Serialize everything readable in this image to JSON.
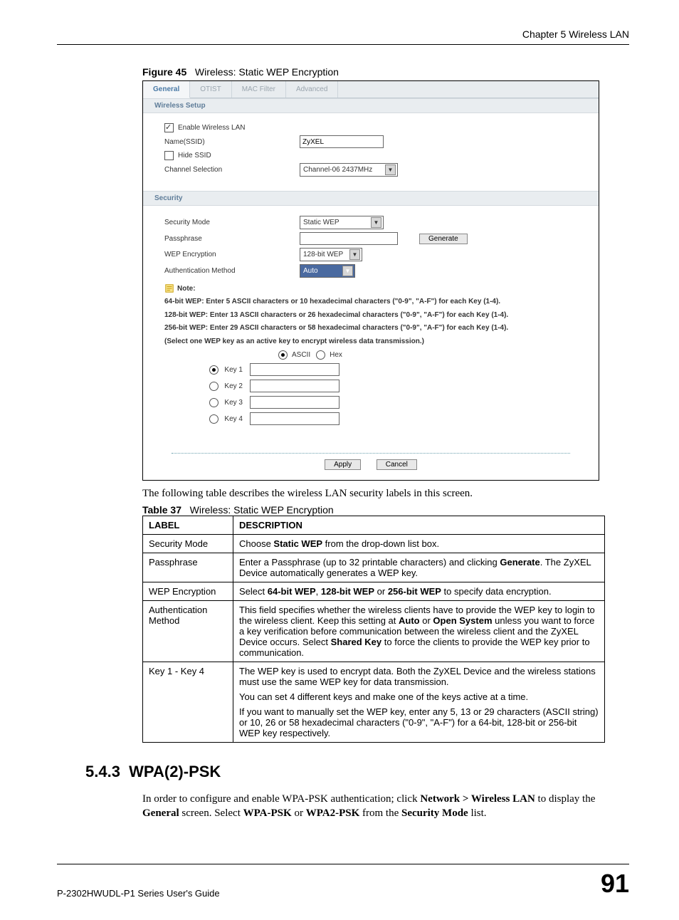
{
  "header": {
    "chapter": "Chapter 5 Wireless LAN"
  },
  "figure": {
    "label": "Figure 45",
    "title": "Wireless: Static WEP Encryption"
  },
  "shot": {
    "tabs": {
      "general": "General",
      "otist": "OTIST",
      "mac": "MAC Filter",
      "advanced": "Advanced"
    },
    "section_wireless": "Wireless Setup",
    "enable_lan": "Enable Wireless LAN",
    "name_ssid_label": "Name(SSID)",
    "name_ssid_value": "ZyXEL",
    "hide_ssid": "Hide SSID",
    "channel_label": "Channel Selection",
    "channel_value": "Channel-06 2437MHz",
    "section_security": "Security",
    "secmode_label": "Security Mode",
    "secmode_value": "Static WEP",
    "passphrase_label": "Passphrase",
    "passphrase_value": "",
    "generate_btn": "Generate",
    "wepenc_label": "WEP Encryption",
    "wepenc_value": "128-bit WEP",
    "authmeth_label": "Authentication Method",
    "authmeth_value": "Auto",
    "note_label": "Note:",
    "note_line1": "64-bit WEP: Enter 5 ASCII characters or 10 hexadecimal characters (\"0-9\", \"A-F\") for each Key (1-4).",
    "note_line2": "128-bit WEP: Enter 13 ASCII characters or 26 hexadecimal characters (\"0-9\", \"A-F\") for each Key (1-4).",
    "note_line3": "256-bit WEP: Enter 29 ASCII characters or 58 hexadecimal characters (\"0-9\", \"A-F\") for each Key (1-4).",
    "note_line4": "(Select one WEP key as an active key to encrypt wireless data transmission.)",
    "fmt_ascii": "ASCII",
    "fmt_hex": "Hex",
    "key1": "Key 1",
    "key2": "Key 2",
    "key3": "Key 3",
    "key4": "Key 4",
    "apply": "Apply",
    "cancel": "Cancel"
  },
  "after_fig_text": "The following table describes the wireless LAN security labels in this screen.",
  "table_caption": {
    "label": "Table 37",
    "title": "Wireless: Static WEP Encryption"
  },
  "table": {
    "head_label": "LABEL",
    "head_desc": "DESCRIPTION",
    "rows": [
      {
        "label": "Security Mode",
        "desc_parts": [
          "Choose ",
          "Static WEP",
          " from the drop-down list box."
        ],
        "bold_idx": [
          1
        ]
      },
      {
        "label": "Passphrase",
        "desc_parts": [
          "Enter a Passphrase (up to 32 printable characters) and clicking ",
          "Generate",
          ". The ZyXEL Device automatically generates a WEP key."
        ],
        "bold_idx": [
          1
        ]
      },
      {
        "label": "WEP Encryption",
        "desc_parts": [
          "Select ",
          "64-bit WEP",
          ", ",
          "128-bit WEP",
          " or ",
          "256-bit WEP",
          " to specify data encryption."
        ],
        "bold_idx": [
          1,
          3,
          5
        ]
      },
      {
        "label": "Authentication Method",
        "desc_parts": [
          "This field specifies whether the wireless clients have to provide the WEP key to login to the wireless client. Keep this setting at ",
          "Auto",
          " or ",
          "Open System",
          " unless you want to force a key verification before communication between the wireless client and the ZyXEL Device occurs. Select ",
          "Shared Key",
          " to force the clients to provide the WEP key prior to communication."
        ],
        "bold_idx": [
          1,
          3,
          5
        ]
      },
      {
        "label": "Key 1 - Key 4",
        "desc_paragraphs": [
          "The WEP key is used to encrypt data. Both the ZyXEL Device and the wireless stations must use the same WEP key for data transmission.",
          "You can set 4 different keys and make one of the keys active at a time.",
          "If you want to manually set the WEP key, enter any 5, 13 or 29 characters (ASCII string) or 10, 26 or 58 hexadecimal characters (\"0-9\", \"A-F\") for a 64-bit, 128-bit or 256-bit WEP key respectively."
        ]
      }
    ]
  },
  "section_543": {
    "num": "5.4.3",
    "title": "WPA(2)-PSK",
    "p_parts": [
      "In order to configure and enable WPA-PSK authentication; click ",
      "Network > Wireless LAN",
      " to display the ",
      "General",
      " screen. Select ",
      "WPA-PSK",
      " or ",
      "WPA2-PSK",
      " from the ",
      "Security Mode",
      " list."
    ],
    "bold_idx": [
      1,
      3,
      5,
      7,
      9
    ]
  },
  "footer": {
    "guide": "P-2302HWUDL-P1 Series User's Guide",
    "page": "91"
  }
}
